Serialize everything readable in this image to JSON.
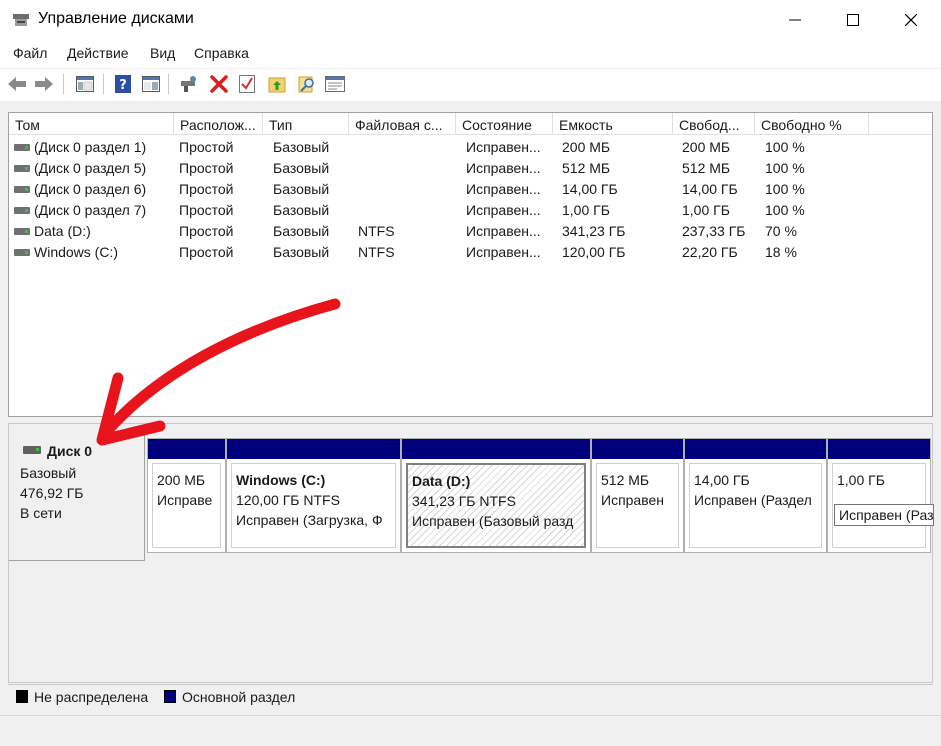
{
  "window": {
    "title": "Управление дисками",
    "app_icon": "disk-management-icon",
    "controls": [
      "minimize-icon",
      "maximize-icon",
      "close-icon"
    ]
  },
  "menu": {
    "items": [
      "Файл",
      "Действие",
      "Вид",
      "Справка"
    ]
  },
  "toolbar": {
    "buttons": [
      "back-arrow-icon",
      "forward-arrow-icon",
      "console-tree-icon",
      "help-icon",
      "properties-pane-icon",
      "connect-disk-icon",
      "delete-icon",
      "properties-check-icon",
      "folder-up-icon",
      "search-icon",
      "list-icon"
    ]
  },
  "volumes": {
    "columns": [
      "Том",
      "Располож...",
      "Тип",
      "Файловая с...",
      "Состояние",
      "Емкость",
      "Свобод...",
      "Свободно %"
    ],
    "rows": [
      [
        "(Диск 0 раздел 1)",
        "Простой",
        "Базовый",
        "",
        "Исправен...",
        "200 МБ",
        "200 МБ",
        "100 %"
      ],
      [
        "(Диск 0 раздел 5)",
        "Простой",
        "Базовый",
        "",
        "Исправен...",
        "512 МБ",
        "512 МБ",
        "100 %"
      ],
      [
        "(Диск 0 раздел 6)",
        "Простой",
        "Базовый",
        "",
        "Исправен...",
        "14,00 ГБ",
        "14,00 ГБ",
        "100 %"
      ],
      [
        "(Диск 0 раздел 7)",
        "Простой",
        "Базовый",
        "",
        "Исправен...",
        "1,00 ГБ",
        "1,00 ГБ",
        "100 %"
      ],
      [
        "Data (D:)",
        "Простой",
        "Базовый",
        "NTFS",
        "Исправен...",
        "341,23 ГБ",
        "237,33 ГБ",
        "70 %"
      ],
      [
        "Windows (C:)",
        "Простой",
        "Базовый",
        "NTFS",
        "Исправен...",
        "120,00 ГБ",
        "22,20 ГБ",
        "18 %"
      ]
    ]
  },
  "disk": {
    "name": "Диск 0",
    "type": "Базовый",
    "size": "476,92 ГБ",
    "status": "В сети",
    "partitions": [
      {
        "title": "",
        "size": "200 МБ",
        "status": "Исправе"
      },
      {
        "title": "Windows  (C:)",
        "size": "120,00 ГБ NTFS",
        "status": "Исправен (Загрузка, Ф"
      },
      {
        "title": "Data  (D:)",
        "size": "341,23 ГБ NTFS",
        "status": "Исправен (Базовый разд"
      },
      {
        "title": "",
        "size": "512 МБ",
        "status": "Исправен"
      },
      {
        "title": "",
        "size": "14,00 ГБ",
        "status": "Исправен (Раздел"
      },
      {
        "title": "",
        "size": "1,00 ГБ",
        "status": ""
      }
    ],
    "tooltip": "Исправен (Разд"
  },
  "legend": {
    "unallocated": "Не распределена",
    "primary": "Основной раздел",
    "unallocated_color": "#000000",
    "primary_color": "#00007d"
  },
  "annotation": {
    "arrow_color": "#e8141c"
  }
}
